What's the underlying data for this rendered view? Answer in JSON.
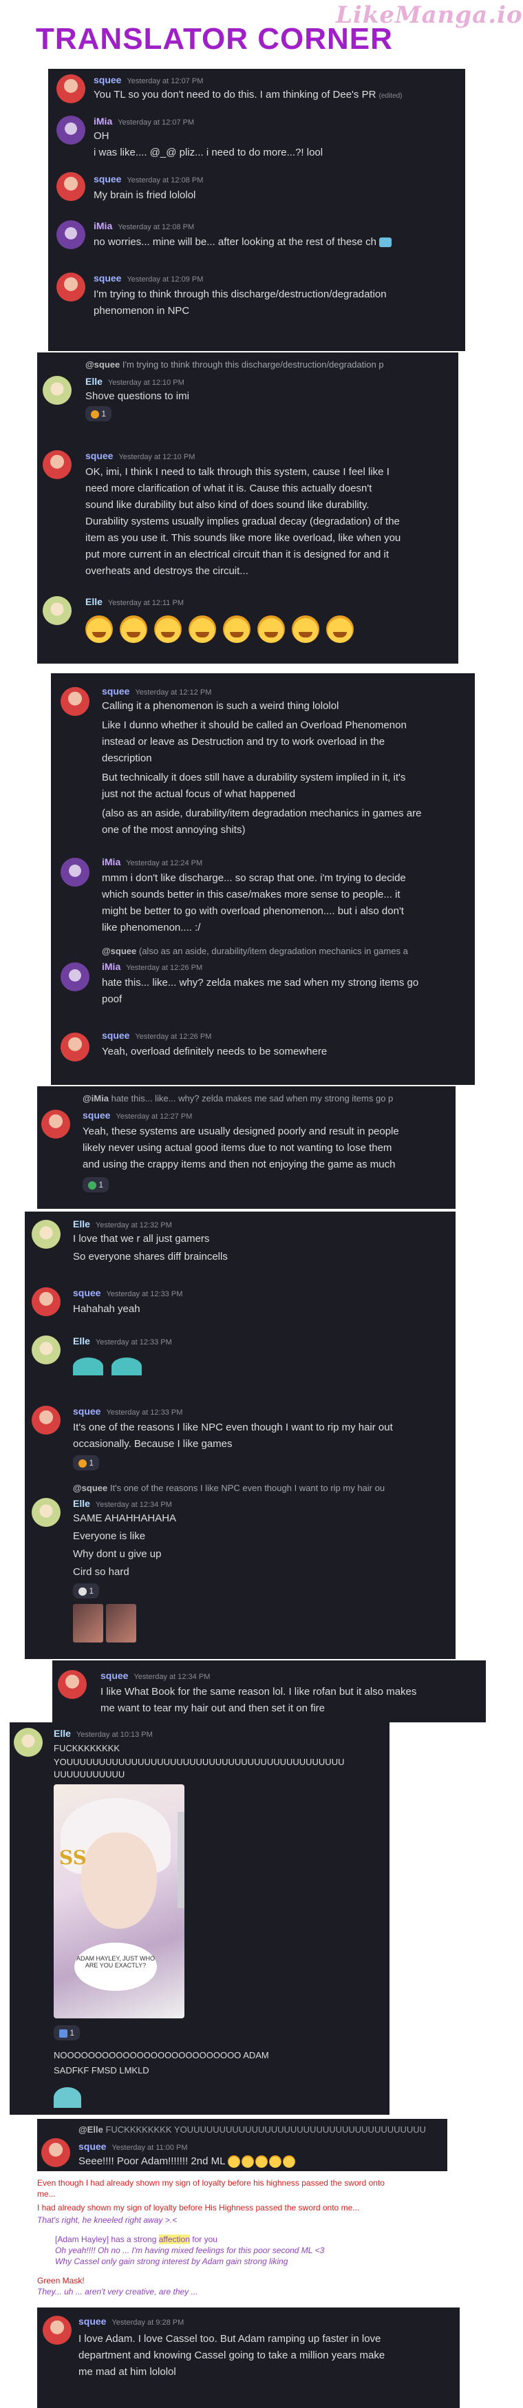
{
  "header": {
    "title": "TRANSLATOR CORNER",
    "watermark": "LikeManga.io"
  },
  "p1": {
    "m1": {
      "name": "squee",
      "ts": "Yesterday at 12:07 PM",
      "text": "You TL so you don't need to do this. I am thinking of Dee's PR",
      "edited": "(edited)"
    },
    "m2": {
      "name": "iMia",
      "ts": "Yesterday at 12:07 PM",
      "l1": "OH",
      "l2": "i was like.... @_@ pliz... i need to do more...?! lool"
    },
    "m3": {
      "name": "squee",
      "ts": "Yesterday at 12:08 PM",
      "text": "My brain is fried lololol"
    },
    "m4": {
      "name": "iMia",
      "ts": "Yesterday at 12:08 PM",
      "text": "no worries... mine will be... after looking at the rest of these ch"
    },
    "m5": {
      "name": "squee",
      "ts": "Yesterday at 12:09 PM",
      "l1": "I'm trying to think through this discharge/destruction/degradation",
      "l2": "phenomenon in NPC"
    }
  },
  "p2": {
    "reply": {
      "name": "@squee",
      "text": "I'm trying to think through this discharge/destruction/degradation p"
    },
    "m1": {
      "name": "Elle",
      "ts": "Yesterday at 12:10 PM",
      "text": "Shove questions to imi",
      "reaction": "1"
    },
    "m2": {
      "name": "squee",
      "ts": "Yesterday at 12:10 PM",
      "lines": [
        "OK, imi, I think I need to talk through this system, cause I feel like I",
        "need more clarification of what it is. Cause this actually doesn't",
        "sound like durability but also kind of does sound like durability.",
        "Durability systems usually implies gradual decay (degradation) of the",
        "item as you use it. This sounds like more like overload, like when you",
        "put more current in an electrical circuit than it is designed for and it",
        "overheats and destroys the circuit..."
      ]
    },
    "m3": {
      "name": "Elle",
      "ts": "Yesterday at 12:11 PM"
    }
  },
  "p3": {
    "m1": {
      "name": "squee",
      "ts": "Yesterday at 12:12 PM",
      "lines": [
        "Calling it a phenomenon is such a weird thing lololol",
        "Like I dunno whether it should be called an Overload Phenomenon",
        "instead or leave as Destruction and try to work overload in the",
        "description",
        "But technically it does still have a durability system implied in it, it's",
        "just not the actual focus of what happened",
        "(also as an aside, durability/item degradation mechanics in games are",
        "one of the most annoying shits)"
      ]
    },
    "m2": {
      "name": "iMia",
      "ts": "Yesterday at 12:24 PM",
      "lines": [
        "mmm i don't like discharge... so scrap that one. i'm trying to decide",
        "which sounds better in this case/makes more sense to people... it",
        "might be better to go with overload phenomenon.... but i also don't",
        "like phenomenon.... :/"
      ]
    },
    "reply": {
      "name": "@squee",
      "text": "(also as an aside, durability/item degradation mechanics in games a"
    },
    "m3": {
      "name": "iMia",
      "ts": "Yesterday at 12:26 PM",
      "l1": "hate this... like... why? zelda makes me sad when my strong items go",
      "l2": "poof"
    },
    "m4": {
      "name": "squee",
      "ts": "Yesterday at 12:26 PM",
      "text": "Yeah, overload definitely needs to be somewhere"
    }
  },
  "p4": {
    "reply": {
      "name": "@iMia",
      "text": "hate this... like... why? zelda makes me sad when my strong items go p"
    },
    "m1": {
      "name": "squee",
      "ts": "Yesterday at 12:27 PM",
      "lines": [
        "Yeah, these systems are usually designed poorly and result in people",
        "likely never using actual good items due to not wanting to lose them",
        "and using the crappy items and then not enjoying the game as much"
      ],
      "reaction": "1"
    }
  },
  "p5": {
    "m1": {
      "name": "Elle",
      "ts": "Yesterday at 12:32 PM",
      "l1": "I love that we r all just gamers",
      "l2": "So everyone shares diff braincells"
    },
    "m2": {
      "name": "squee",
      "ts": "Yesterday at 12:33 PM",
      "text": "Hahahah yeah"
    },
    "m3": {
      "name": "Elle",
      "ts": "Yesterday at 12:33 PM"
    },
    "m4": {
      "name": "squee",
      "ts": "Yesterday at 12:33 PM",
      "l1": "It's one of the reasons I like NPC even though I want to rip my hair out",
      "l2": "occasionally. Because I like games",
      "reaction": "1"
    },
    "reply": {
      "name": "@squee",
      "text": "It's one of the reasons I like NPC even though I want to rip my hair ou"
    },
    "m5": {
      "name": "Elle",
      "ts": "Yesterday at 12:34 PM",
      "lines": [
        "SAME AHAHHAHAHA",
        "Everyone is like",
        "Why dont u give up",
        "Cird so hard"
      ],
      "reaction": "1"
    }
  },
  "p6": {
    "m1": {
      "name": "squee",
      "ts": "Yesterday at 12:34 PM",
      "l1": "I like What Book for the same reason lol. I like rofan but it also makes",
      "l2": "me want to tear my hair out and then set it on fire"
    }
  },
  "p7": {
    "m1": {
      "name": "Elle",
      "ts": "Yesterday at 10:13 PM",
      "l1": "FUCKKKKKKKK",
      "l2": "YOUUUUUUUUUUUUUUUUUUUUUUUUUUUUUUUUUUUUUUUUUUU",
      "l3": "UUUUUUUUUUU",
      "reaction": "1",
      "l4": "NOOOOOOOOOOOOOOOOOOOOOOOOOO ADAM",
      "l5": "SADFKF FMSD LMKLD"
    },
    "manga": {
      "bubble": "ADAM HAYLEY, JUST WHO ARE YOU EXACTLY?"
    }
  },
  "p8": {
    "reply": {
      "name": "@Elle",
      "text": "FUCKKKKKKKK YOUUUUUUUUUUUUUUUUUUUUUUUUUUUUUUUUUUUUU"
    },
    "m1": {
      "name": "squee",
      "ts": "Yesterday at 11:00 PM",
      "text": "Seee!!!! Poor Adam!!!!!!! 2nd ML"
    }
  },
  "textpage": {
    "r1": "Even though I had already shown my sign of loyalty before his highness passed the sword onto",
    "r1b": "me...",
    "r2": "I had already shown my sign of loyalty before His Highness passed the sword onto me...",
    "r3": "That's right, he kneeled right away >.<",
    "p1a": "[Adam Hayley] has a strong ",
    "p1h": "affection",
    "p1b": " for you",
    "p2": "Oh yeah!!!! Oh no ... I'm having mixed feelings for this poor second ML <3",
    "p3": "Why Cassel only gain strong interest by Adam gain strong liking",
    "g1": "Green Mask!",
    "g2": "They... uh ... aren't very creative, are they ..."
  },
  "p9": {
    "m1": {
      "name": "squee",
      "ts": "Yesterday at 9:28 PM",
      "lines": [
        "I love Adam. I love Cassel too. But Adam ramping up faster in love",
        "department and knowing Cassel going to take a million years make",
        "me mad at him lololol"
      ]
    }
  }
}
